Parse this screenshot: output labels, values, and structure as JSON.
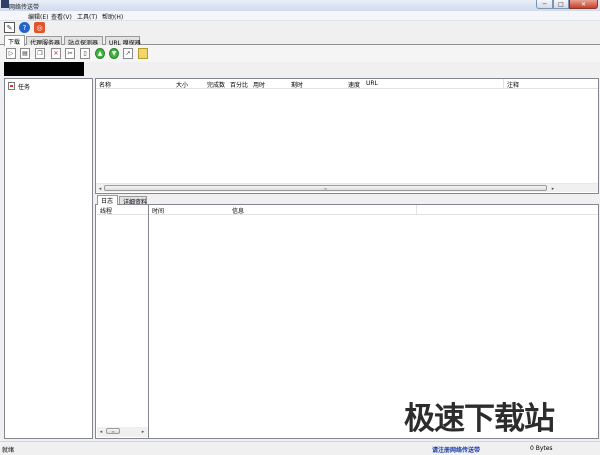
{
  "window": {
    "title": "网络传送带",
    "close_glyph": "✕",
    "min_glyph": "─",
    "max_glyph": "□"
  },
  "menu": [
    "编辑(E)",
    "查看(V)",
    "工具(T)",
    "帮助(H)"
  ],
  "small_toolbar": [
    {
      "icon": "edit-icon",
      "glyph": "✎"
    },
    {
      "icon": "help-icon",
      "glyph": "?"
    },
    {
      "icon": "stop-icon",
      "glyph": "◎"
    }
  ],
  "tabs": [
    "下载",
    "代理服务器",
    "站点探测器",
    "URL 嗅探器"
  ],
  "main_toolbar": [
    {
      "icon": "start-icon",
      "glyph": "▷"
    },
    {
      "icon": "page-icon",
      "glyph": "▤"
    },
    {
      "icon": "pages-icon",
      "glyph": "❐"
    },
    {
      "icon": "delete-icon",
      "glyph": "✕"
    },
    {
      "icon": "cut-icon",
      "glyph": "✂"
    },
    {
      "icon": "doc-icon",
      "glyph": "▯"
    },
    {
      "icon": "up-icon",
      "glyph": "▲"
    },
    {
      "icon": "down-icon",
      "glyph": "▼"
    },
    {
      "icon": "open-icon",
      "glyph": "↗"
    },
    {
      "icon": "folder-icon",
      "glyph": ""
    }
  ],
  "task_tree": {
    "label": "任务"
  },
  "list": {
    "columns": [
      "名称",
      "大小",
      "完成数",
      "百分比",
      "用时",
      "剩时",
      "速度",
      "URL",
      "注释"
    ],
    "rows": [],
    "scroll_thumb_glyph": "≡",
    "left_arrow": "◂",
    "right_arrow": "▸"
  },
  "bottom_tabs": [
    "日志",
    "详细资料"
  ],
  "log": {
    "thread_header": "线程",
    "columns": [
      "时间",
      "信息"
    ],
    "rows": []
  },
  "status": {
    "ready": "就绪",
    "register": "请注册网络传送带",
    "bytes": "0 Bytes"
  },
  "watermark": "极速下载站"
}
